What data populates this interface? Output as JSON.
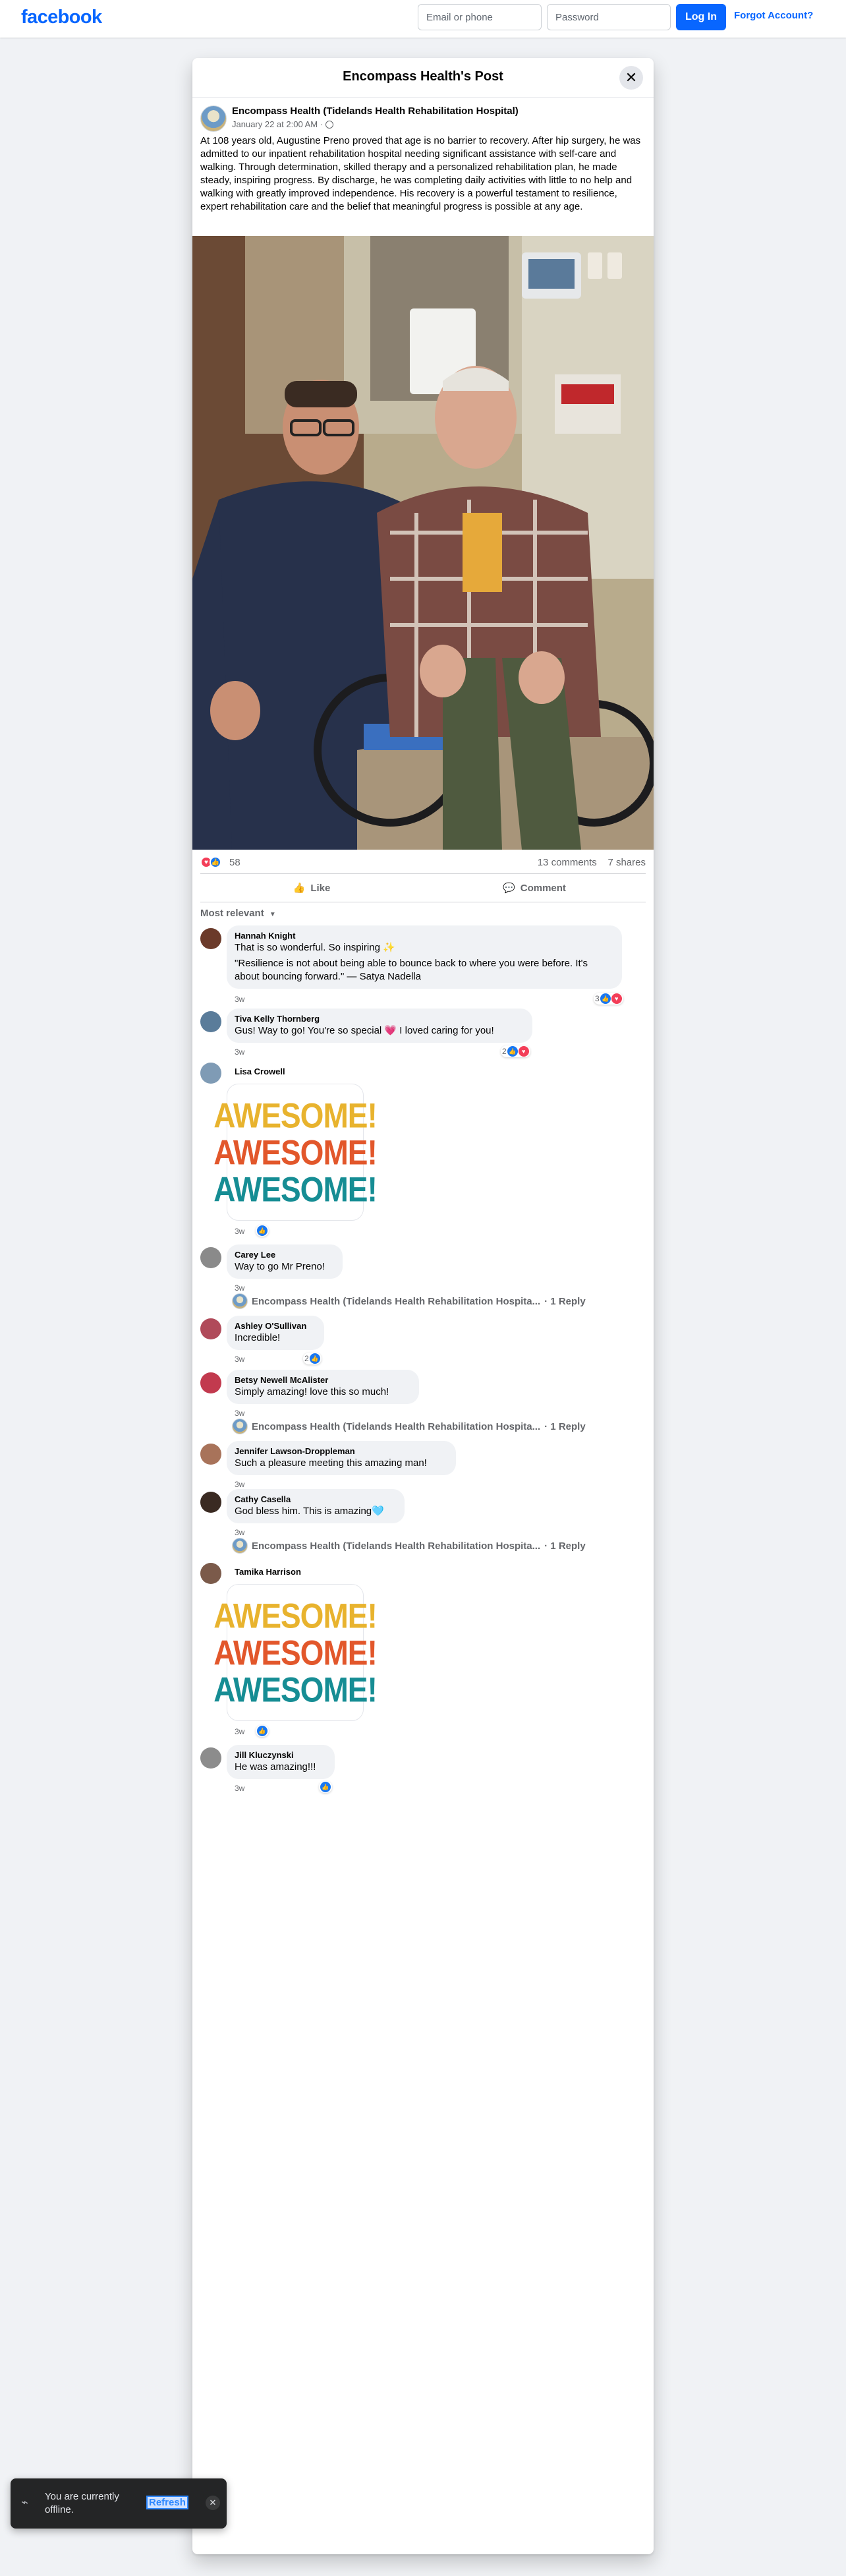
{
  "topbar": {
    "logo": "facebook",
    "email_placeholder": "Email or phone",
    "password_placeholder": "Password",
    "login_label": "Log In",
    "forgot_label": "Forgot Account?"
  },
  "dialog": {
    "title": "Encompass Health's Post",
    "close_icon": "close-icon"
  },
  "post": {
    "author": "Encompass Health (Tidelands Health Rehabilitation Hospital)",
    "date": "January 22 at 2:00 AM",
    "separator": "·",
    "text": "At 108 years old, Augustine Preno proved that age is no barrier to recovery. After hip surgery, he was admitted to our inpatient rehabilitation hospital needing significant assistance with self-care and walking. Through determination, skilled therapy and a personalized rehabilitation plan, he made steady, inspiring progress. By discharge, he was completing daily activities with little to no help and walking with greatly improved independence. His recovery is a powerful testament to resilience, expert rehabilitation care and the belief that meaningful progress is possible at any age.",
    "reaction_count": "58",
    "comments_count": "13 comments",
    "shares_count": "7 shares",
    "like_label": "Like",
    "comment_label": "Comment",
    "sort_label": "Most relevant"
  },
  "comments": [
    {
      "name": "Hannah Knight",
      "text": "That is so wonderful. So inspiring ✨",
      "text2": "\"Resilience is not about being able to bounce back to where you were before. It's about bouncing forward.\" — Satya Nadella",
      "time": "3w",
      "react_count": "3"
    },
    {
      "name": "Tiva Kelly Thornberg",
      "text": "Gus! Way to go! You're so special 💗 I loved caring for you!",
      "time": "3w",
      "react_count": "2"
    },
    {
      "name": "Lisa Crowell",
      "gif_words": [
        "AWESOME!",
        "AWESOME!",
        "AWESOME!"
      ],
      "time": "3w"
    },
    {
      "name": "Carey Lee",
      "text": "Way to go Mr Preno!",
      "time": "3w"
    },
    {
      "name": "Ashley O'Sullivan",
      "text": "Incredible!",
      "time": "3w",
      "react_count": "2"
    },
    {
      "name": "Betsy Newell McAlister",
      "text": "Simply amazing! love this so much!",
      "time": "3w"
    },
    {
      "name": "Jennifer Lawson-Droppleman",
      "text": "Such a pleasure meeting this amazing man!",
      "time": "3w"
    },
    {
      "name": "Cathy Casella",
      "text": "God bless him. This is amazing🩵",
      "time": "3w"
    },
    {
      "name": "Tamika Harrison",
      "gif_words": [
        "AWESOME!",
        "AWESOME!",
        "AWESOME!"
      ],
      "time": "3w"
    },
    {
      "name": "Jill Kluczynski",
      "text": "He was amazing!!!",
      "time": "3w"
    }
  ],
  "reply_preview": {
    "author": "Encompass Health (Tidelands Health Rehabilitation Hospita...",
    "count": "· 1 Reply"
  },
  "toast": {
    "text": "You are currently offline.",
    "refresh": "Refresh"
  },
  "colors": {
    "brand": "#0866ff",
    "gif_yellow": "#e8b32e",
    "gif_orange": "#e2572b",
    "gif_teal": "#168d94"
  }
}
